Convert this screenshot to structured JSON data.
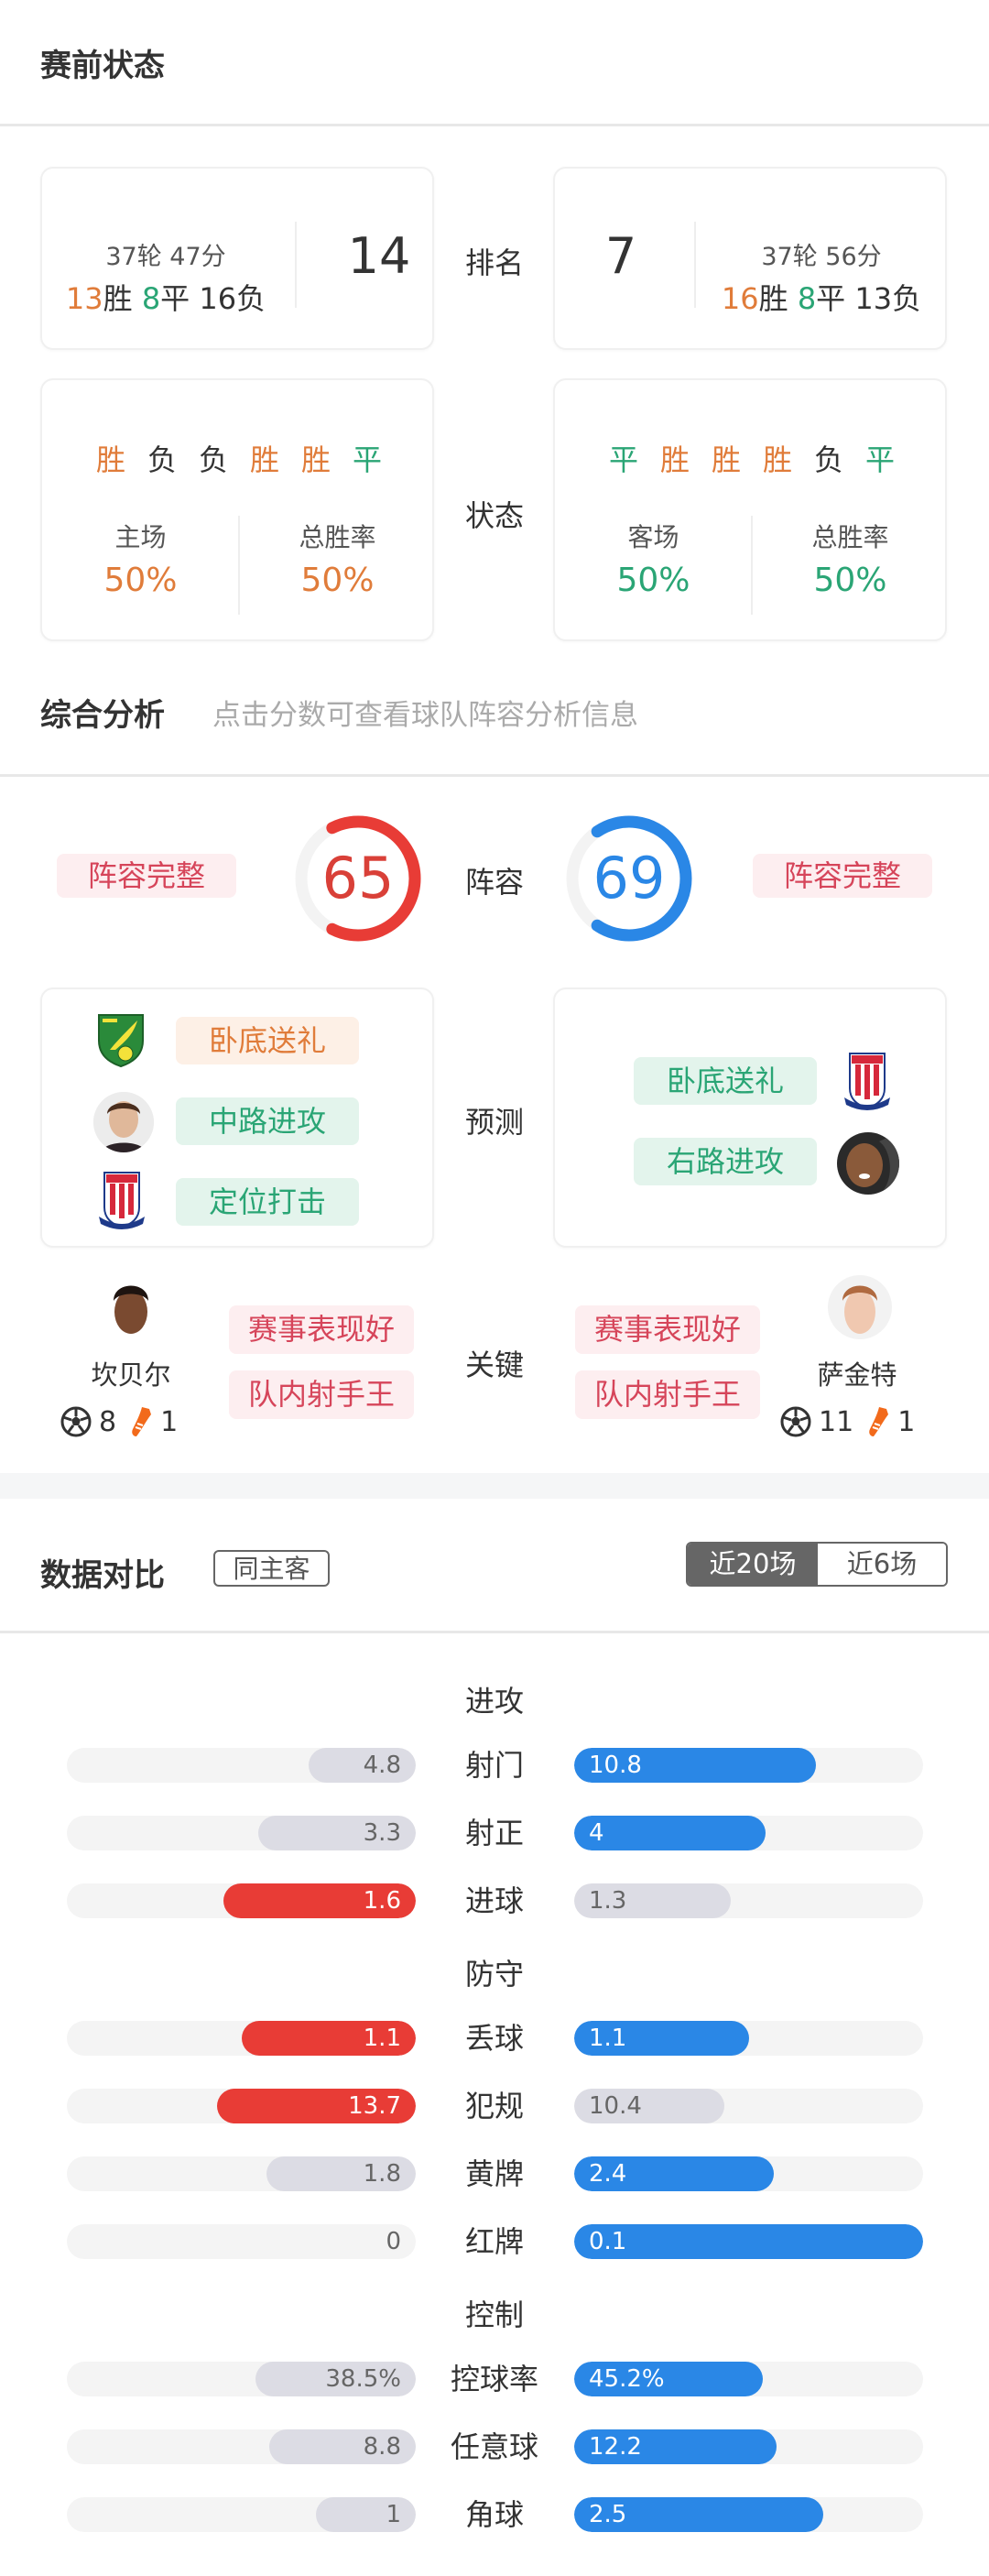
{
  "pre_match": {
    "title": "赛前状态",
    "rank_label": "排名",
    "status_label": "状态",
    "home": {
      "rounds_points": "37轮 47分",
      "wins": "13",
      "wins_suffix": "胜",
      "draws": "8",
      "draws_suffix": "平",
      "losses_text": "16负",
      "rank": "14",
      "form": [
        {
          "result": "胜",
          "type": "win"
        },
        {
          "result": "负",
          "type": "loss"
        },
        {
          "result": "负",
          "type": "loss"
        },
        {
          "result": "胜",
          "type": "win"
        },
        {
          "result": "胜",
          "type": "win"
        },
        {
          "result": "平",
          "type": "draw"
        }
      ],
      "venue_label": "主场",
      "venue_rate": "50%",
      "total_label": "总胜率",
      "total_rate": "50%"
    },
    "away": {
      "rounds_points": "37轮 56分",
      "wins": "16",
      "wins_suffix": "胜",
      "draws": "8",
      "draws_suffix": "平",
      "losses_text": "13负",
      "rank": "7",
      "form": [
        {
          "result": "平",
          "type": "draw"
        },
        {
          "result": "胜",
          "type": "win"
        },
        {
          "result": "胜",
          "type": "win"
        },
        {
          "result": "胜",
          "type": "win"
        },
        {
          "result": "负",
          "type": "loss"
        },
        {
          "result": "平",
          "type": "draw"
        }
      ],
      "venue_label": "客场",
      "venue_rate": "50%",
      "total_label": "总胜率",
      "total_rate": "50%"
    }
  },
  "analysis": {
    "title": "综合分析",
    "hint": "点击分数可查看球队阵容分析信息",
    "lineup_label": "阵容",
    "prediction_label": "预测",
    "key_label": "关键",
    "home_lineup": {
      "score": 65,
      "score_text": "65",
      "status": "阵容完整"
    },
    "away_lineup": {
      "score": 69,
      "score_text": "69",
      "status": "阵容完整"
    },
    "home_predictions": [
      {
        "icon": "norwich-crest-icon",
        "text": "卧底送礼",
        "style": "orange"
      },
      {
        "icon": "player-avatar",
        "text": "中路进攻",
        "style": "green"
      },
      {
        "icon": "stoke-crest-icon",
        "text": "定位打击",
        "style": "green"
      }
    ],
    "away_predictions": [
      {
        "icon": "stoke-crest-icon",
        "text": "卧底送礼",
        "style": "green"
      },
      {
        "icon": "player-avatar",
        "text": "右路进攻",
        "style": "green"
      }
    ],
    "home_key_player": {
      "name": "坎贝尔",
      "goals": "8",
      "assists": "1",
      "tags": [
        "赛事表现好",
        "队内射手王"
      ]
    },
    "away_key_player": {
      "name": "萨金特",
      "goals": "11",
      "assists": "1",
      "tags": [
        "赛事表现好",
        "队内射手王"
      ]
    }
  },
  "comparison": {
    "title": "数据对比",
    "filter_label": "同主客",
    "tabs": [
      {
        "label": "近20场",
        "active": true
      },
      {
        "label": "近6场",
        "active": false
      }
    ],
    "colors": {
      "home": "#e83c36",
      "away": "#2a87e6",
      "neutral": "#dcdce4",
      "track": "#f4f4f4"
    }
  },
  "chart_data": {
    "type": "table",
    "title": "数据对比",
    "sections": [
      {
        "name": "进攻",
        "rows": [
          {
            "label": "射门",
            "home": 4.8,
            "away": 10.8,
            "home_text": "4.8",
            "away_text": "10.8"
          },
          {
            "label": "射正",
            "home": 3.3,
            "away": 4,
            "home_text": "3.3",
            "away_text": "4"
          },
          {
            "label": "进球",
            "home": 1.6,
            "away": 1.3,
            "home_text": "1.6",
            "away_text": "1.3"
          }
        ]
      },
      {
        "name": "防守",
        "rows": [
          {
            "label": "丢球",
            "home": 1.1,
            "away": 1.1,
            "home_text": "1.1",
            "away_text": "1.1"
          },
          {
            "label": "犯规",
            "home": 13.7,
            "away": 10.4,
            "home_text": "13.7",
            "away_text": "10.4"
          },
          {
            "label": "黄牌",
            "home": 1.8,
            "away": 2.4,
            "home_text": "1.8",
            "away_text": "2.4"
          },
          {
            "label": "红牌",
            "home": 0,
            "away": 0.1,
            "home_text": "0",
            "away_text": "0.1"
          }
        ]
      },
      {
        "name": "控制",
        "rows": [
          {
            "label": "控球率",
            "home": 38.5,
            "away": 45.2,
            "home_text": "38.5%",
            "away_text": "45.2%"
          },
          {
            "label": "任意球",
            "home": 8.8,
            "away": 12.2,
            "home_text": "8.8",
            "away_text": "12.2"
          },
          {
            "label": "角球",
            "home": 1,
            "away": 2.5,
            "home_text": "1",
            "away_text": "2.5"
          }
        ]
      }
    ]
  }
}
